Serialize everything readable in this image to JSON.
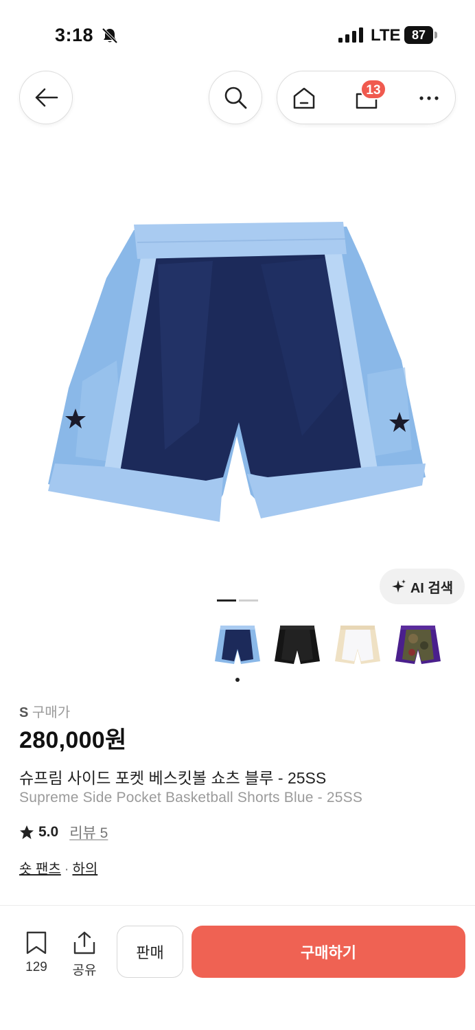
{
  "status_bar": {
    "time": "3:18",
    "network": "LTE",
    "battery": "87"
  },
  "nav": {
    "cart_count": "13"
  },
  "gallery": {
    "ai_search_label": "AI 검색",
    "thumbnail_count": 4
  },
  "product": {
    "size_prefix": "S",
    "price_label": "구매가",
    "price": "280,000원",
    "name_ko": "슈프림 사이드 포켓 베스킷볼 쇼츠 블루 - 25SS",
    "name_en": "Supreme Side Pocket Basketball Shorts Blue - 25SS",
    "rating": "5.0",
    "review_label": "리뷰 5",
    "category_1": "숏 팬츠",
    "category_sep": "·",
    "category_2": "하의"
  },
  "bottom_bar": {
    "bookmark_count": "129",
    "share_label": "공유",
    "sell_label": "판매",
    "buy_label": "구매하기"
  },
  "colors": {
    "accent": "#ef6253",
    "badge": "#f05a4f"
  },
  "icons": [
    "back-arrow-icon",
    "search-icon",
    "home-icon",
    "shopping-bag-icon",
    "more-icon",
    "sparkle-icon",
    "star-icon",
    "bookmark-icon",
    "share-icon",
    "bell-off-icon"
  ]
}
